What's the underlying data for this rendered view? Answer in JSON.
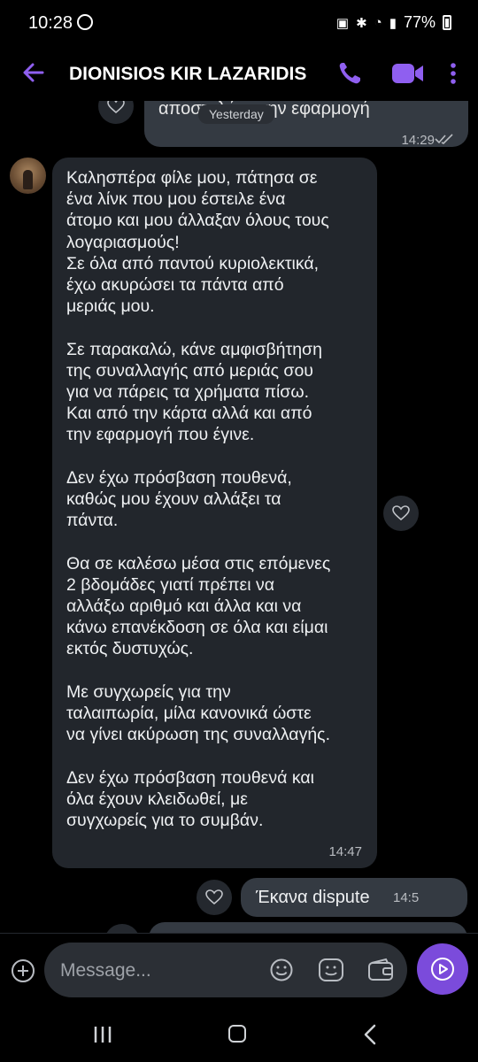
{
  "status_bar": {
    "time": "10:28",
    "battery": "77%",
    "icons": [
      "viber-icon",
      "sim-icon",
      "bluetooth-icon",
      "wifi-icon",
      "volte-icon",
      "signal-icon",
      "battery-icon"
    ]
  },
  "header": {
    "contact_name": "DIONISIOS KIR LAZARIDIS",
    "icons": [
      "back-arrow-icon",
      "phone-call-icon",
      "video-call-icon",
      "more-vert-icon"
    ],
    "accent_color": "#7b4bdb"
  },
  "date_separator": "Yesterday",
  "messages": [
    {
      "direction": "outgoing",
      "text": "αποστολής στην εφαρμογή",
      "time": "14:29",
      "status": "read"
    },
    {
      "direction": "incoming",
      "paragraphs": [
        "Καλησπέρα φίλε μου, πάτησα σε\nένα λίνκ που μου έστειλε ένα\nάτομο και μου άλλαξαν όλους τους\nλογαριασμούς!\nΣε όλα από παντού κυριολεκτικά,\nέχω ακυρώσει τα πάντα από\nμεριάς μου.",
        "Σε παρακαλώ, κάνε αμφισβήτηση\nτης συναλλαγής από μεριάς σου\nγια να πάρεις τα χρήματα πίσω.\nΚαι από την κάρτα αλλά και από\nτην εφαρμογή που έγινε.",
        "Δεν έχω πρόσβαση πουθενά,\nκαθώς μου έχουν αλλάξει τα\nπάντα.",
        "Θα σε καλέσω μέσα στις επόμενες\n2 βδομάδες γιατί πρέπει να\nαλλάξω αριθμό και άλλα και να\nκάνω επανέκδοση σε όλα και είμαι\nεκτός δυστυχώς.",
        "Με συγχωρείς για την\nταλαιπωρία, μίλα κανονικά ώστε\nνα γίνει ακύρωση της συναλλαγής.",
        "Δεν έχω πρόσβαση πουθενά και\nόλα έχουν κλειδωθεί, με\nσυγχωρείς για το συμβάν."
      ],
      "time": "14:47"
    },
    {
      "direction": "outgoing",
      "text": "Έκανα dispute",
      "time": "14:5"
    }
  ],
  "composer": {
    "placeholder": "Message...",
    "icons": [
      "add-icon",
      "emoji-icon",
      "sticker-icon",
      "wallet-icon",
      "send-icon"
    ]
  },
  "nav_bar": {
    "icons": [
      "recent-apps-icon",
      "home-icon",
      "back-icon"
    ]
  }
}
